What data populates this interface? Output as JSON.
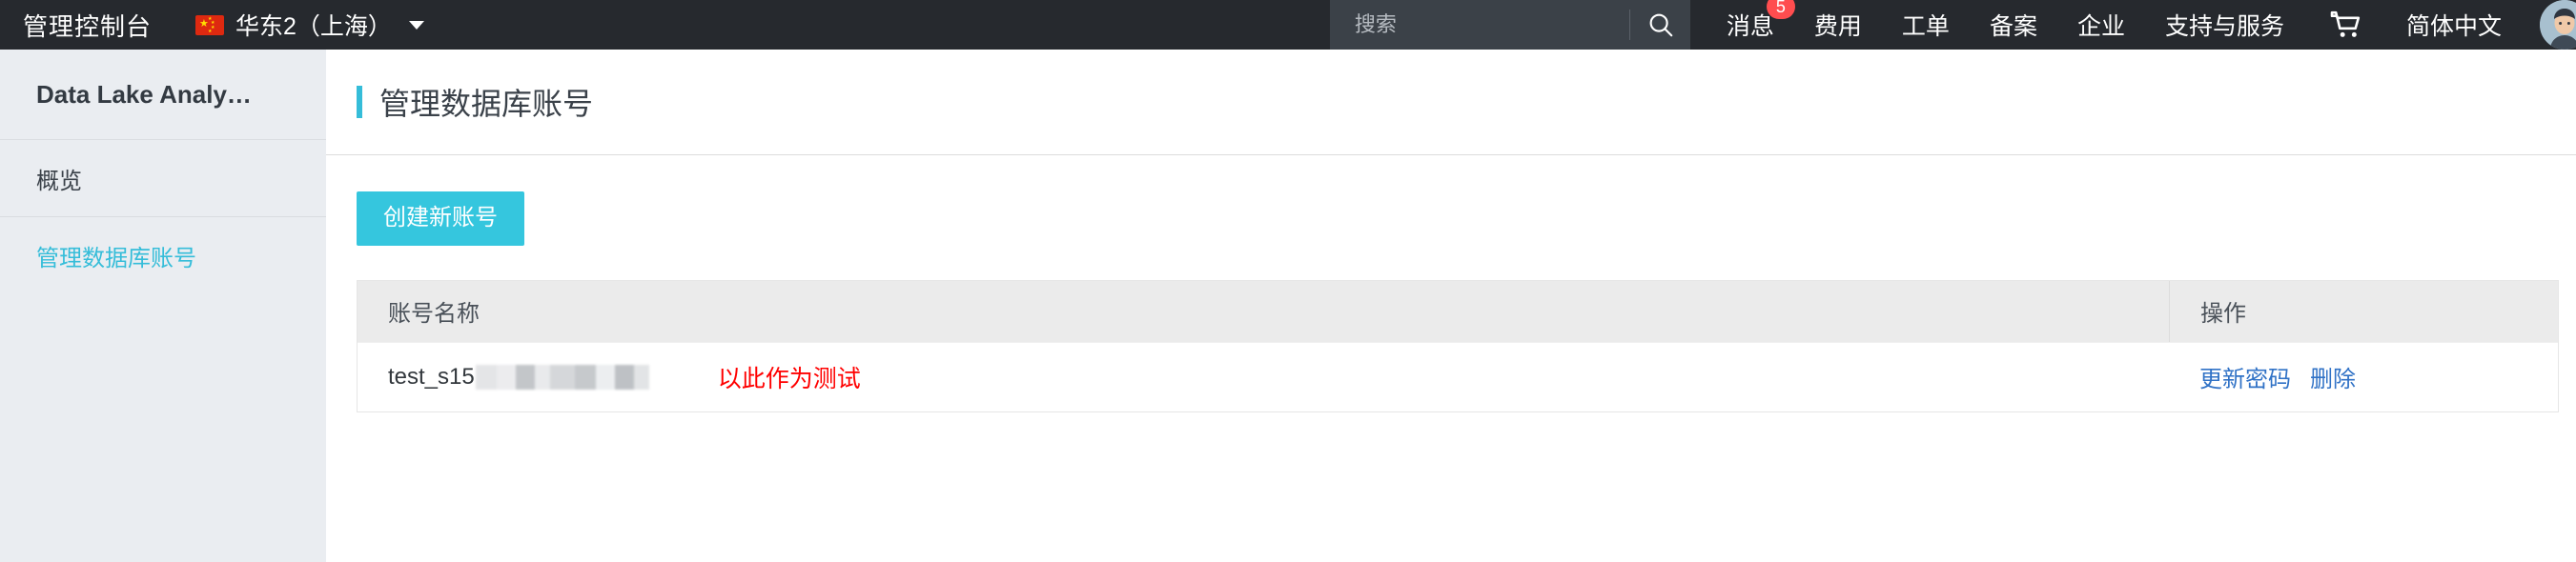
{
  "topbar": {
    "console_title": "管理控制台",
    "region": {
      "flag": "cn-flag-icon",
      "name": "华东2（上海）"
    },
    "search": {
      "placeholder": "搜索",
      "value": "",
      "icon": "search-icon"
    },
    "nav": [
      {
        "label": "消息",
        "badge": "5"
      },
      {
        "label": "费用",
        "badge": ""
      },
      {
        "label": "工单",
        "badge": ""
      },
      {
        "label": "备案",
        "badge": ""
      },
      {
        "label": "企业",
        "badge": ""
      },
      {
        "label": "支持与服务",
        "badge": ""
      }
    ],
    "cart_icon": "shopping-cart-icon",
    "language": "简体中文",
    "avatar": "user-avatar"
  },
  "sidebar": {
    "brand": "Data Lake Analy…",
    "items": [
      {
        "label": "概览",
        "active": false
      },
      {
        "label": "管理数据库账号",
        "active": true
      }
    ]
  },
  "main": {
    "page_title": "管理数据库账号",
    "create_button": "创建新账号",
    "table": {
      "columns": [
        "账号名称",
        "操作"
      ],
      "rows": [
        {
          "account_name": "test_s15",
          "account_name_redacted": true,
          "annotation": "以此作为测试",
          "actions": [
            "更新密码",
            "删除"
          ]
        }
      ]
    }
  },
  "colors": {
    "topbar_bg": "#26292e",
    "search_bg": "#3b4148",
    "accent_cyan": "#35bdd9",
    "button_cyan": "#35c6de",
    "sidebar_bg": "#eaedf1",
    "link_blue": "#3072c6",
    "annotation_red": "#ff0000",
    "badge_red": "#ff4d4f",
    "table_head_bg": "#ebebeb"
  }
}
